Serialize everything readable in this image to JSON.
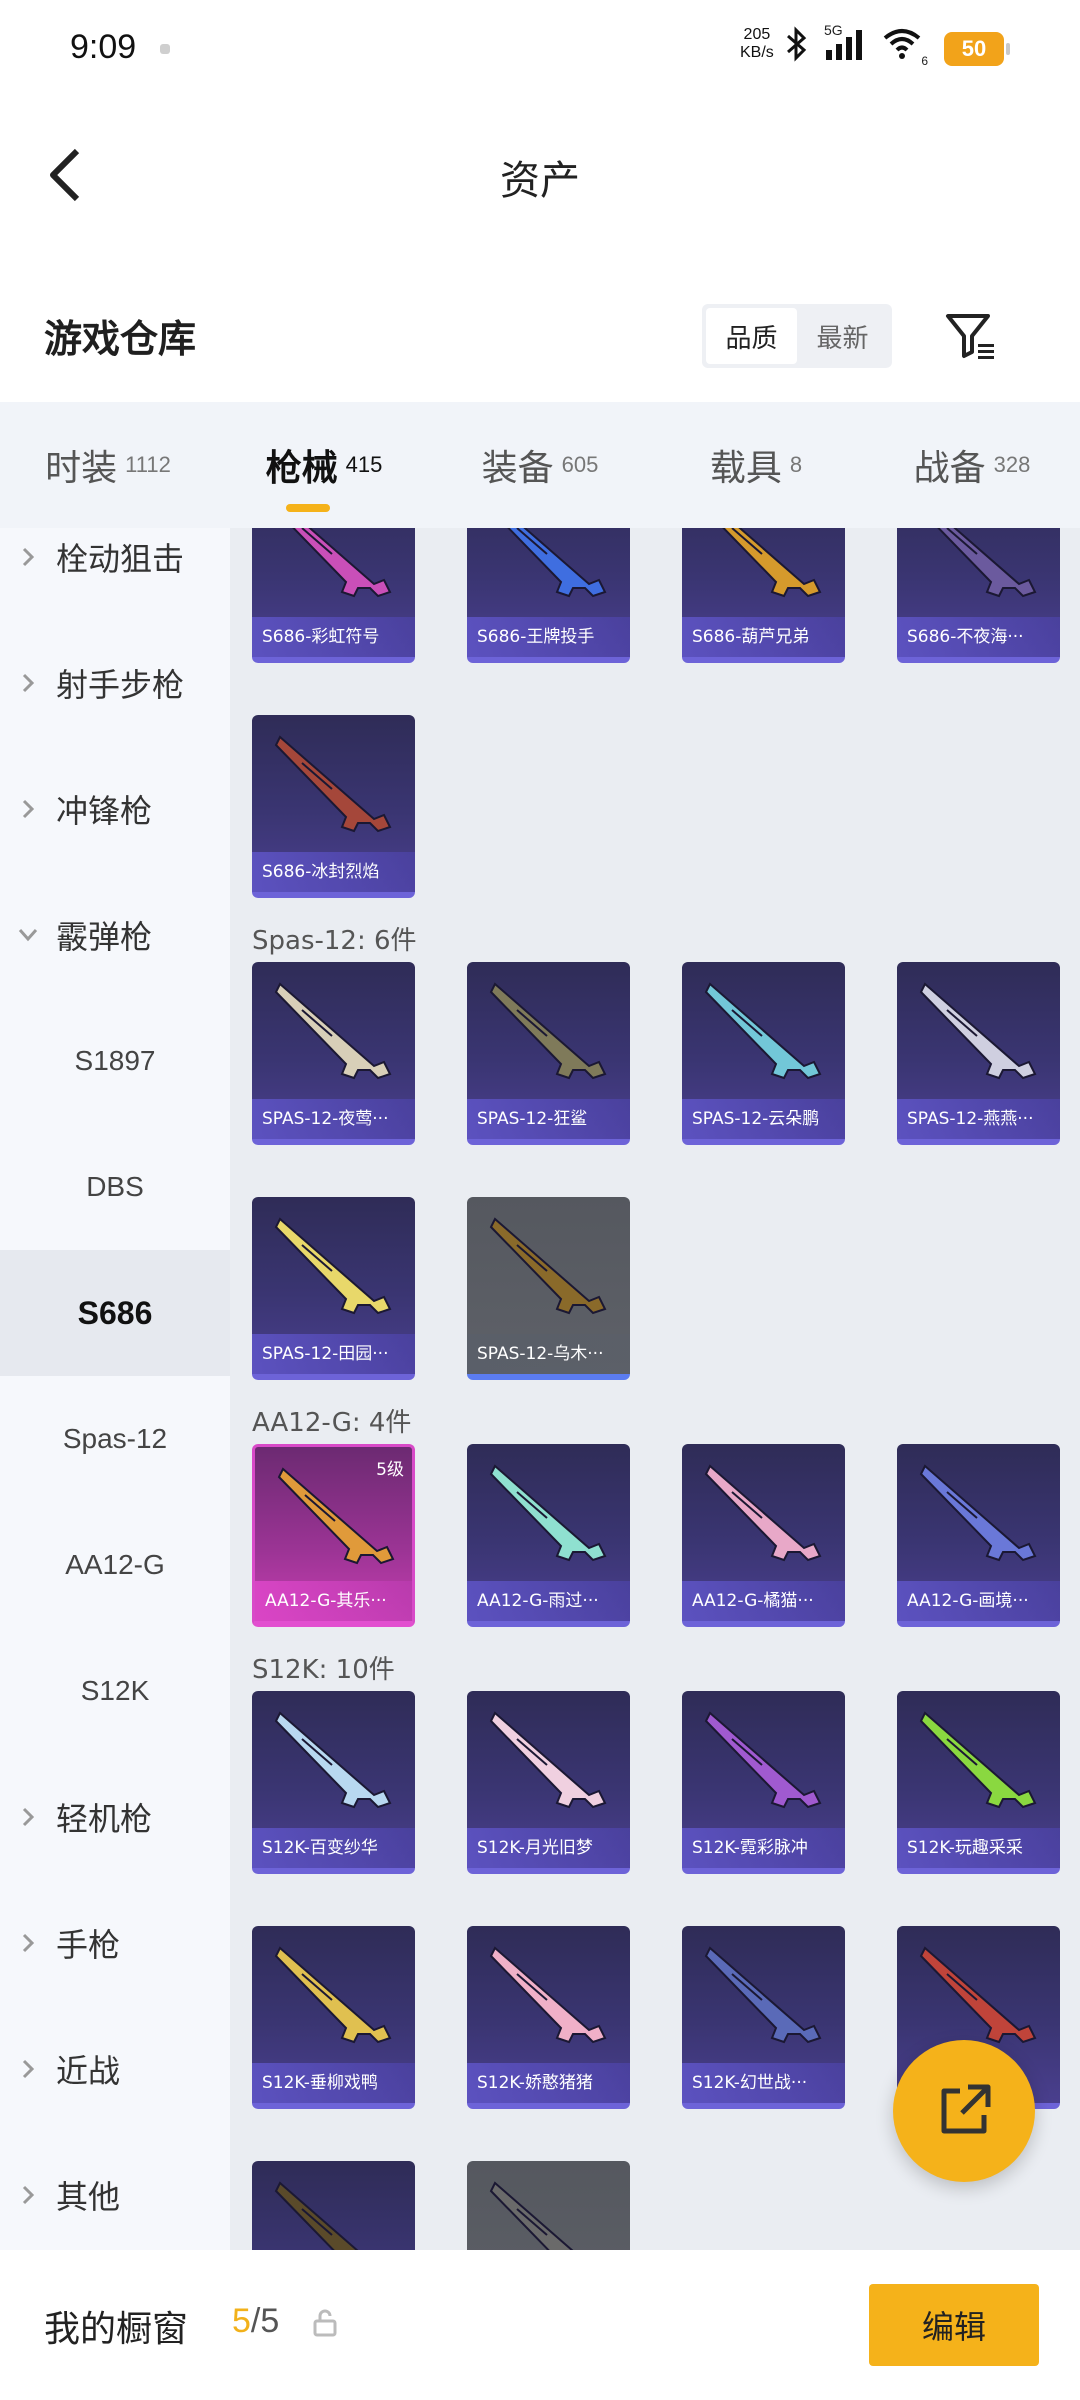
{
  "status_bar": {
    "time": "9:09",
    "net_speed_value": "205",
    "net_speed_unit": "KB/s",
    "network": "5G",
    "wifi_level": "6",
    "battery": "50"
  },
  "header": {
    "title": "资产",
    "back_icon": "chevron-left-icon"
  },
  "section": {
    "title": "游戏仓库",
    "sort_options": [
      {
        "label": "品质",
        "active": true
      },
      {
        "label": "最新",
        "active": false
      }
    ],
    "filter_icon": "filter-icon"
  },
  "category_tabs": [
    {
      "label": "时装",
      "count": "1112",
      "active": false
    },
    {
      "label": "枪械",
      "count": "415",
      "active": true
    },
    {
      "label": "装备",
      "count": "605",
      "active": false
    },
    {
      "label": "载具",
      "count": "8",
      "active": false
    },
    {
      "label": "战备",
      "count": "328",
      "active": false
    }
  ],
  "sidebar": {
    "items": [
      {
        "label": "栓动狙击",
        "type": "group",
        "expanded": false
      },
      {
        "label": "射手步枪",
        "type": "group",
        "expanded": false
      },
      {
        "label": "冲锋枪",
        "type": "group",
        "expanded": false
      },
      {
        "label": "霰弹枪",
        "type": "group",
        "expanded": true
      },
      {
        "label": "S1897",
        "type": "sub"
      },
      {
        "label": "DBS",
        "type": "sub"
      },
      {
        "label": "S686",
        "type": "sub",
        "selected": true
      },
      {
        "label": "Spas-12",
        "type": "sub"
      },
      {
        "label": "AA12-G",
        "type": "sub"
      },
      {
        "label": "S12K",
        "type": "sub"
      },
      {
        "label": "轻机枪",
        "type": "group",
        "expanded": false
      },
      {
        "label": "手枪",
        "type": "group",
        "expanded": false
      },
      {
        "label": "近战",
        "type": "group",
        "expanded": false
      },
      {
        "label": "其他",
        "type": "group",
        "expanded": false
      }
    ]
  },
  "groups": [
    {
      "title": "",
      "items": [
        {
          "name": "S686-彩虹符号",
          "style": "purple",
          "gun_color": "#c94fb8"
        },
        {
          "name": "S686-王牌投手",
          "style": "purple",
          "gun_color": "#3f6ee0"
        },
        {
          "name": "S686-葫芦兄弟",
          "style": "purple",
          "gun_color": "#d59a2c"
        },
        {
          "name": "S686-不夜海···",
          "style": "purple",
          "gun_color": "#6b5a9e"
        },
        {
          "name": "S686-冰封烈焰",
          "style": "purple",
          "gun_color": "#a5473a"
        }
      ]
    },
    {
      "title": "Spas-12: 6件",
      "items": [
        {
          "name": "SPAS-12-夜莺···",
          "style": "purple",
          "gun_color": "#d8cfb8"
        },
        {
          "name": "SPAS-12-狂鲨",
          "style": "purple",
          "gun_color": "#7f7a5a"
        },
        {
          "name": "SPAS-12-云朵鹏",
          "style": "purple",
          "gun_color": "#72c7d8"
        },
        {
          "name": "SPAS-12-燕燕···",
          "style": "purple",
          "gun_color": "#cfcfe0"
        },
        {
          "name": "SPAS-12-田园···",
          "style": "purple",
          "gun_color": "#e8d86a"
        },
        {
          "name": "SPAS-12-乌木···",
          "style": "gray",
          "gun_color": "#8a6a2a"
        }
      ]
    },
    {
      "title": "AA12-G: 4件",
      "items": [
        {
          "name": "AA12-G-其乐···",
          "style": "pink",
          "gun_color": "#e09a3a",
          "badge": "5级"
        },
        {
          "name": "AA12-G-雨过···",
          "style": "purple",
          "gun_color": "#8fe0d0"
        },
        {
          "name": "AA12-G-橘猫···",
          "style": "purple",
          "gun_color": "#e8a8c8"
        },
        {
          "name": "AA12-G-画境···",
          "style": "purple",
          "gun_color": "#6a78d8"
        }
      ]
    },
    {
      "title": "S12K: 10件",
      "items": [
        {
          "name": "S12K-百变纱华",
          "style": "purple",
          "gun_color": "#b8d8f0"
        },
        {
          "name": "S12K-月光旧梦",
          "style": "purple",
          "gun_color": "#f0d0e0"
        },
        {
          "name": "S12K-霓彩脉冲",
          "style": "purple",
          "gun_color": "#a05ad0"
        },
        {
          "name": "S12K-玩趣采采",
          "style": "purple",
          "gun_color": "#8ad840"
        },
        {
          "name": "S12K-垂柳戏鸭",
          "style": "purple",
          "gun_color": "#e0c050"
        },
        {
          "name": "S12K-娇憨猪猪",
          "style": "purple",
          "gun_color": "#f0b0c8"
        },
        {
          "name": "S12K-幻世战···",
          "style": "purple",
          "gun_color": "#5a6ab8"
        },
        {
          "name": "",
          "style": "purple",
          "gun_color": "#c0443a"
        },
        {
          "name": "",
          "style": "purple",
          "gun_color": "#5a4a2a"
        },
        {
          "name": "",
          "style": "gray",
          "gun_color": "#6a6a6a"
        }
      ]
    }
  ],
  "fab_icon": "open-external-icon",
  "bottom_bar": {
    "label": "我的橱窗",
    "current": "5",
    "total": "/5",
    "lock_icon": "lock-icon",
    "edit_label": "编辑"
  },
  "colors": {
    "accent": "#f5b21a",
    "card_purple": "#3a3572",
    "card_pink": "#c63fb0"
  }
}
